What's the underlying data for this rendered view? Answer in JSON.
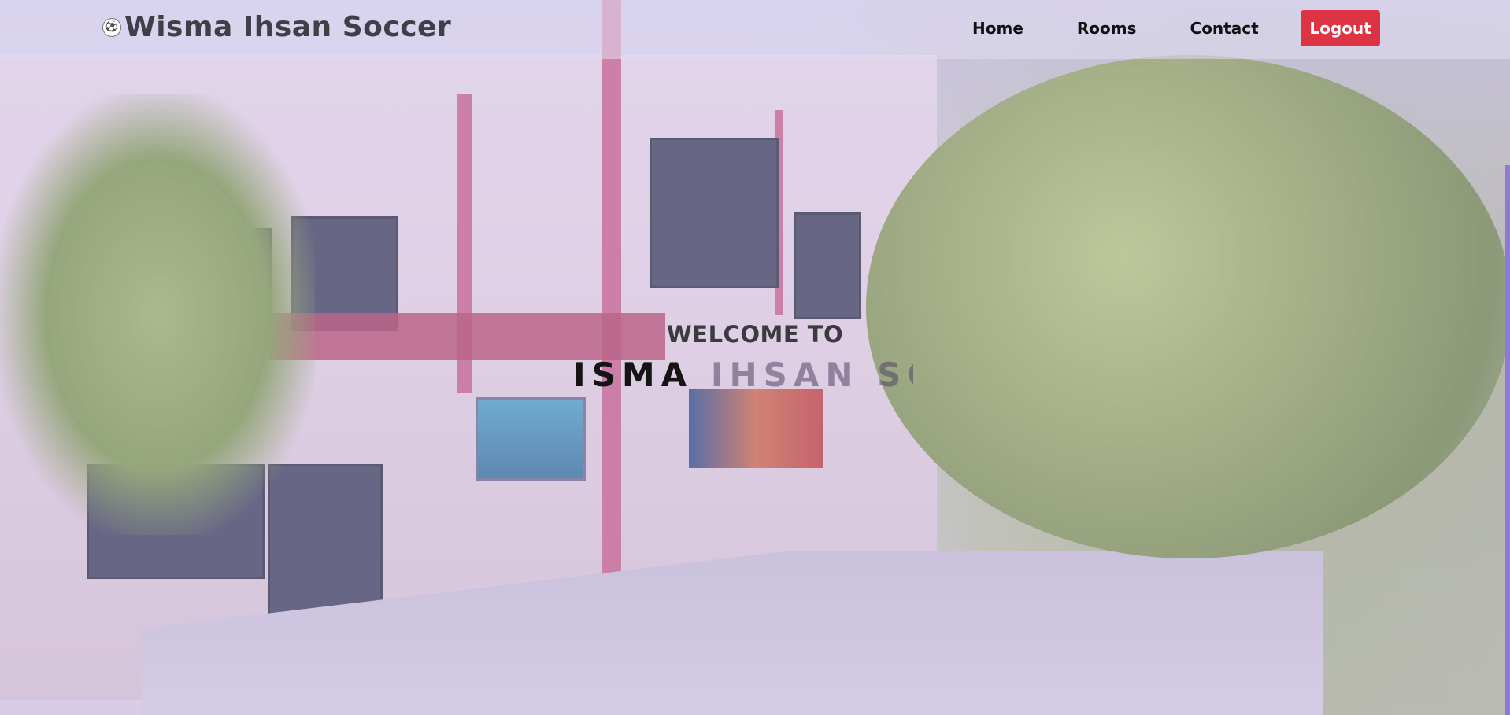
{
  "brand": {
    "logo_icon": "soccer-ball-icon",
    "logo_glyph": "⚽",
    "name": "Wisma Ihsan Soccer"
  },
  "nav": {
    "items": [
      {
        "label": "Home"
      },
      {
        "label": "Rooms"
      },
      {
        "label": "Contact"
      }
    ],
    "logout_label": "Logout"
  },
  "hero": {
    "welcome": "WELCOME TO",
    "title_visible_dark": "ISMA ",
    "title_visible_faded": "IHSAN SOCC"
  },
  "colors": {
    "logout_bg": "#dc3444",
    "nav_text": "#111111",
    "brand_text": "#3f3f47"
  }
}
